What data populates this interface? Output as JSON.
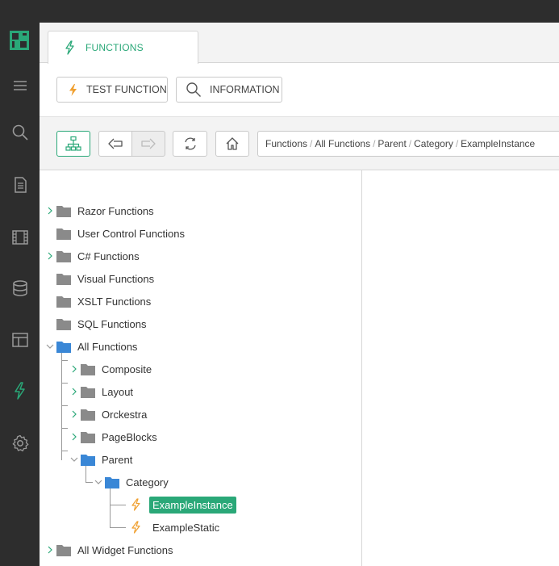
{
  "tab": {
    "label": "FUNCTIONS"
  },
  "toolbar": {
    "test_function_label": "TEST FUNCTION",
    "information_label": "INFORMATION"
  },
  "breadcrumb": {
    "items": [
      "Functions",
      "All Functions",
      "Parent",
      "Category",
      "ExampleInstance"
    ],
    "separator": "/"
  },
  "tree": {
    "razor": "Razor Functions",
    "user_control": "User Control Functions",
    "csharp": "C# Functions",
    "visual": "Visual Functions",
    "xslt": "XSLT Functions",
    "sql": "SQL Functions",
    "all_functions": "All Functions",
    "composite": "Composite",
    "layout": "Layout",
    "orckestra": "Orckestra",
    "pageblocks": "PageBlocks",
    "parent": "Parent",
    "category": "Category",
    "example_instance": "ExampleInstance",
    "example_static": "ExampleStatic",
    "all_widget": "All Widget Functions"
  },
  "colors": {
    "accent": "#2aa878",
    "folder_gray": "#8a8a8a",
    "folder_blue": "#3a87d6",
    "bolt_orange": "#f0a030",
    "rail": "#2d2d2d"
  }
}
